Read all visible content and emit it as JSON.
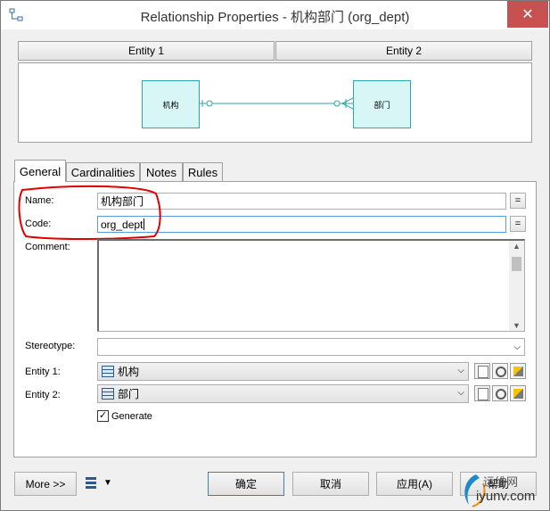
{
  "window": {
    "title": "Relationship Properties - 机构部门 (org_dept)",
    "close_glyph": "✕"
  },
  "entity_headers": {
    "entity1": "Entity 1",
    "entity2": "Entity 2"
  },
  "diagram": {
    "entity1_name": "机构",
    "entity2_name": "部门"
  },
  "tabs": [
    "General",
    "Cardinalities",
    "Notes",
    "Rules"
  ],
  "general": {
    "name_label": "Name:",
    "name_value": "机构部门",
    "code_label": "Code:",
    "code_value": "org_dept",
    "comment_label": "Comment:",
    "stereotype_label": "Stereotype:",
    "entity1_label": "Entity 1:",
    "entity1_value": "机构",
    "entity2_label": "Entity 2:",
    "entity2_value": "部门",
    "generate_label": "Generate",
    "generate_checked": true,
    "eq_glyph": "="
  },
  "footer": {
    "more_label": "More >>",
    "ok_label": "确定",
    "cancel_label": "取消",
    "apply_label": "应用(A)",
    "help_label": "帮助"
  },
  "watermark": {
    "line1": "运维网",
    "line2": "iyunv.com"
  },
  "colors": {
    "entity_fill": "#d8f6f6",
    "entity_border": "#2aa7a7",
    "highlight": "#e00000",
    "close": "#c75050"
  }
}
